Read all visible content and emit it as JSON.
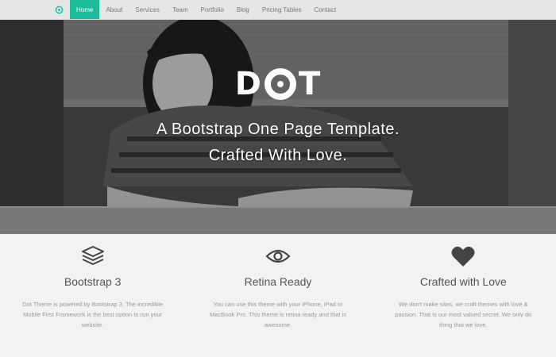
{
  "navbar": {
    "items": [
      {
        "label": "Home",
        "active": true
      },
      {
        "label": "About"
      },
      {
        "label": "Services"
      },
      {
        "label": "Team"
      },
      {
        "label": "Portfolio"
      },
      {
        "label": "Blog"
      },
      {
        "label": "Pricing Tables"
      },
      {
        "label": "Contact"
      }
    ],
    "accent_color": "#1abc9c"
  },
  "hero": {
    "logo_d": "D",
    "logo_t": "T",
    "tagline_line1": "A Bootstrap One Page Template.",
    "tagline_line2": "Crafted With Love."
  },
  "features": [
    {
      "icon": "layers-icon",
      "title": "Bootstrap 3",
      "desc": "Dot Theme is powered by Bootstrap 3. The incredible Mobile First Framework is the best option to run your website."
    },
    {
      "icon": "eye-icon",
      "title": "Retina Ready",
      "desc": "You can use this theme with your iPhone, iPad or MacBook Pro. This theme is retina ready and that is awesome."
    },
    {
      "icon": "heart-icon",
      "title": "Crafted with Love",
      "desc": "We don't make sites, we craft themes with love & passion. That is our most valued secret. We only do thing that we love."
    }
  ]
}
